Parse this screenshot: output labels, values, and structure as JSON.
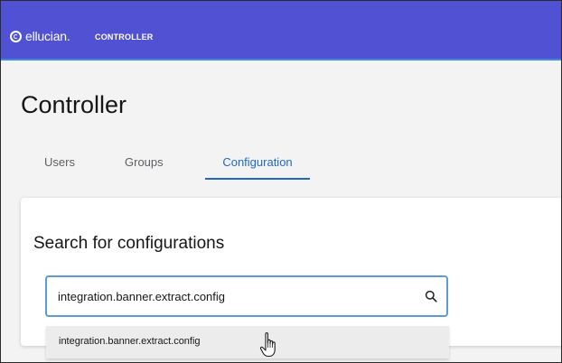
{
  "header": {
    "logo_text": "ellucian.",
    "app_name": "CONTROLLER"
  },
  "page": {
    "title": "Controller"
  },
  "tabs": [
    {
      "label": "Users",
      "active": false
    },
    {
      "label": "Groups",
      "active": false
    },
    {
      "label": "Configuration",
      "active": true
    }
  ],
  "search_card": {
    "title": "Search for configurations",
    "input_value": "integration.banner.extract.config",
    "icon": "search-icon"
  },
  "autocomplete": {
    "items": [
      {
        "label": "integration.banner.extract.config"
      }
    ]
  },
  "colors": {
    "header_bg": "#5151d3",
    "header_accent": "#3f8ae6",
    "active_tab": "#1e67c2",
    "input_focus_border": "#5b9bd5"
  }
}
